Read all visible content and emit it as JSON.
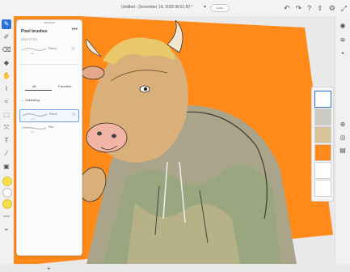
{
  "document": {
    "title": "Untitled - December 14, 2020 W.61.50 *",
    "status": "auto"
  },
  "panel": {
    "title": "Pixel brushes",
    "more": "•••",
    "section_label": "SELECTED",
    "selected_brush": {
      "name": "Pencil",
      "sub": "2.0"
    },
    "tabs": [
      "All",
      "Favorites"
    ],
    "back_label": "Sketching",
    "brushes": [
      {
        "name": "Pencil",
        "sub": "2.0"
      },
      {
        "name": "Pen",
        "sub": "2.0"
      }
    ],
    "add": "+"
  },
  "colors": {
    "canvas_bg": "#ff8a1a",
    "accent": "#2c6fd6",
    "swatch_yellow": "#f5e04a",
    "swatch_white": "#ffffff"
  },
  "icons": {
    "top": [
      "undo-icon",
      "redo-icon",
      "help-icon",
      "share-icon",
      "settings-icon",
      "fullscreen-icon"
    ],
    "right_rail": [
      "layers-icon",
      "adjust-icon",
      "comment-icon"
    ]
  }
}
